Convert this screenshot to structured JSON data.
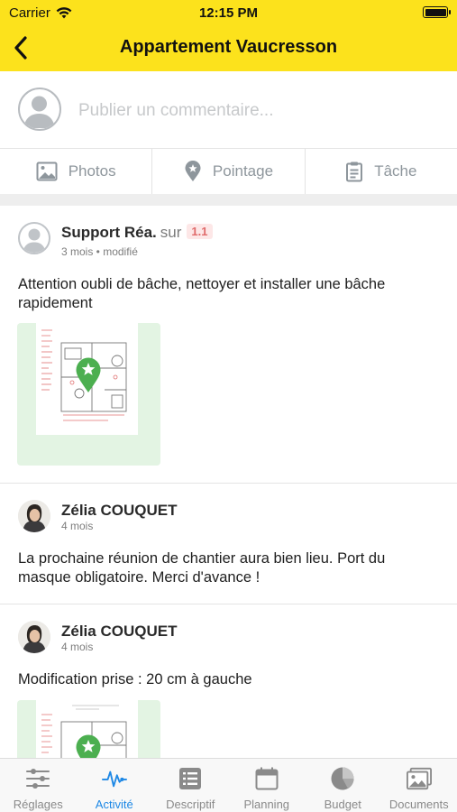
{
  "status_bar": {
    "carrier": "Carrier",
    "time": "12:15 PM"
  },
  "header": {
    "title": "Appartement Vaucresson"
  },
  "composer": {
    "placeholder": "Publier un commentaire..."
  },
  "actions": [
    {
      "label": "Photos",
      "icon": "image-icon"
    },
    {
      "label": "Pointage",
      "icon": "location-pin-star-icon"
    },
    {
      "label": "Tâche",
      "icon": "clipboard-icon"
    }
  ],
  "posts": [
    {
      "author": "Support Réa.",
      "sur": "sur",
      "badge": "1.1",
      "meta": "3 mois • modifié",
      "text": "Attention oubli de bâche, nettoyer et installer une bâche rapidement",
      "has_plan_image": true
    },
    {
      "author": "Zélia COUQUET",
      "meta": "4 mois",
      "text": "La prochaine réunion de chantier aura bien lieu. Port du masque obligatoire. Merci d'avance !"
    },
    {
      "author": "Zélia COUQUET",
      "meta": "4 mois",
      "text": "Modification prise : 20 cm à gauche",
      "has_plan_image": true
    }
  ],
  "tabs": [
    {
      "label": "Réglages",
      "icon": "sliders-icon",
      "active": false
    },
    {
      "label": "Activité",
      "icon": "pulse-icon",
      "active": true
    },
    {
      "label": "Descriptif",
      "icon": "list-icon",
      "active": false
    },
    {
      "label": "Planning",
      "icon": "calendar-icon",
      "active": false
    },
    {
      "label": "Budget",
      "icon": "pie-chart-icon",
      "active": false
    },
    {
      "label": "Documents",
      "icon": "photos-icon",
      "active": false
    }
  ],
  "colors": {
    "brand": "#fce21c",
    "active_tab": "#1e88e5",
    "pin": "#4caf50"
  }
}
